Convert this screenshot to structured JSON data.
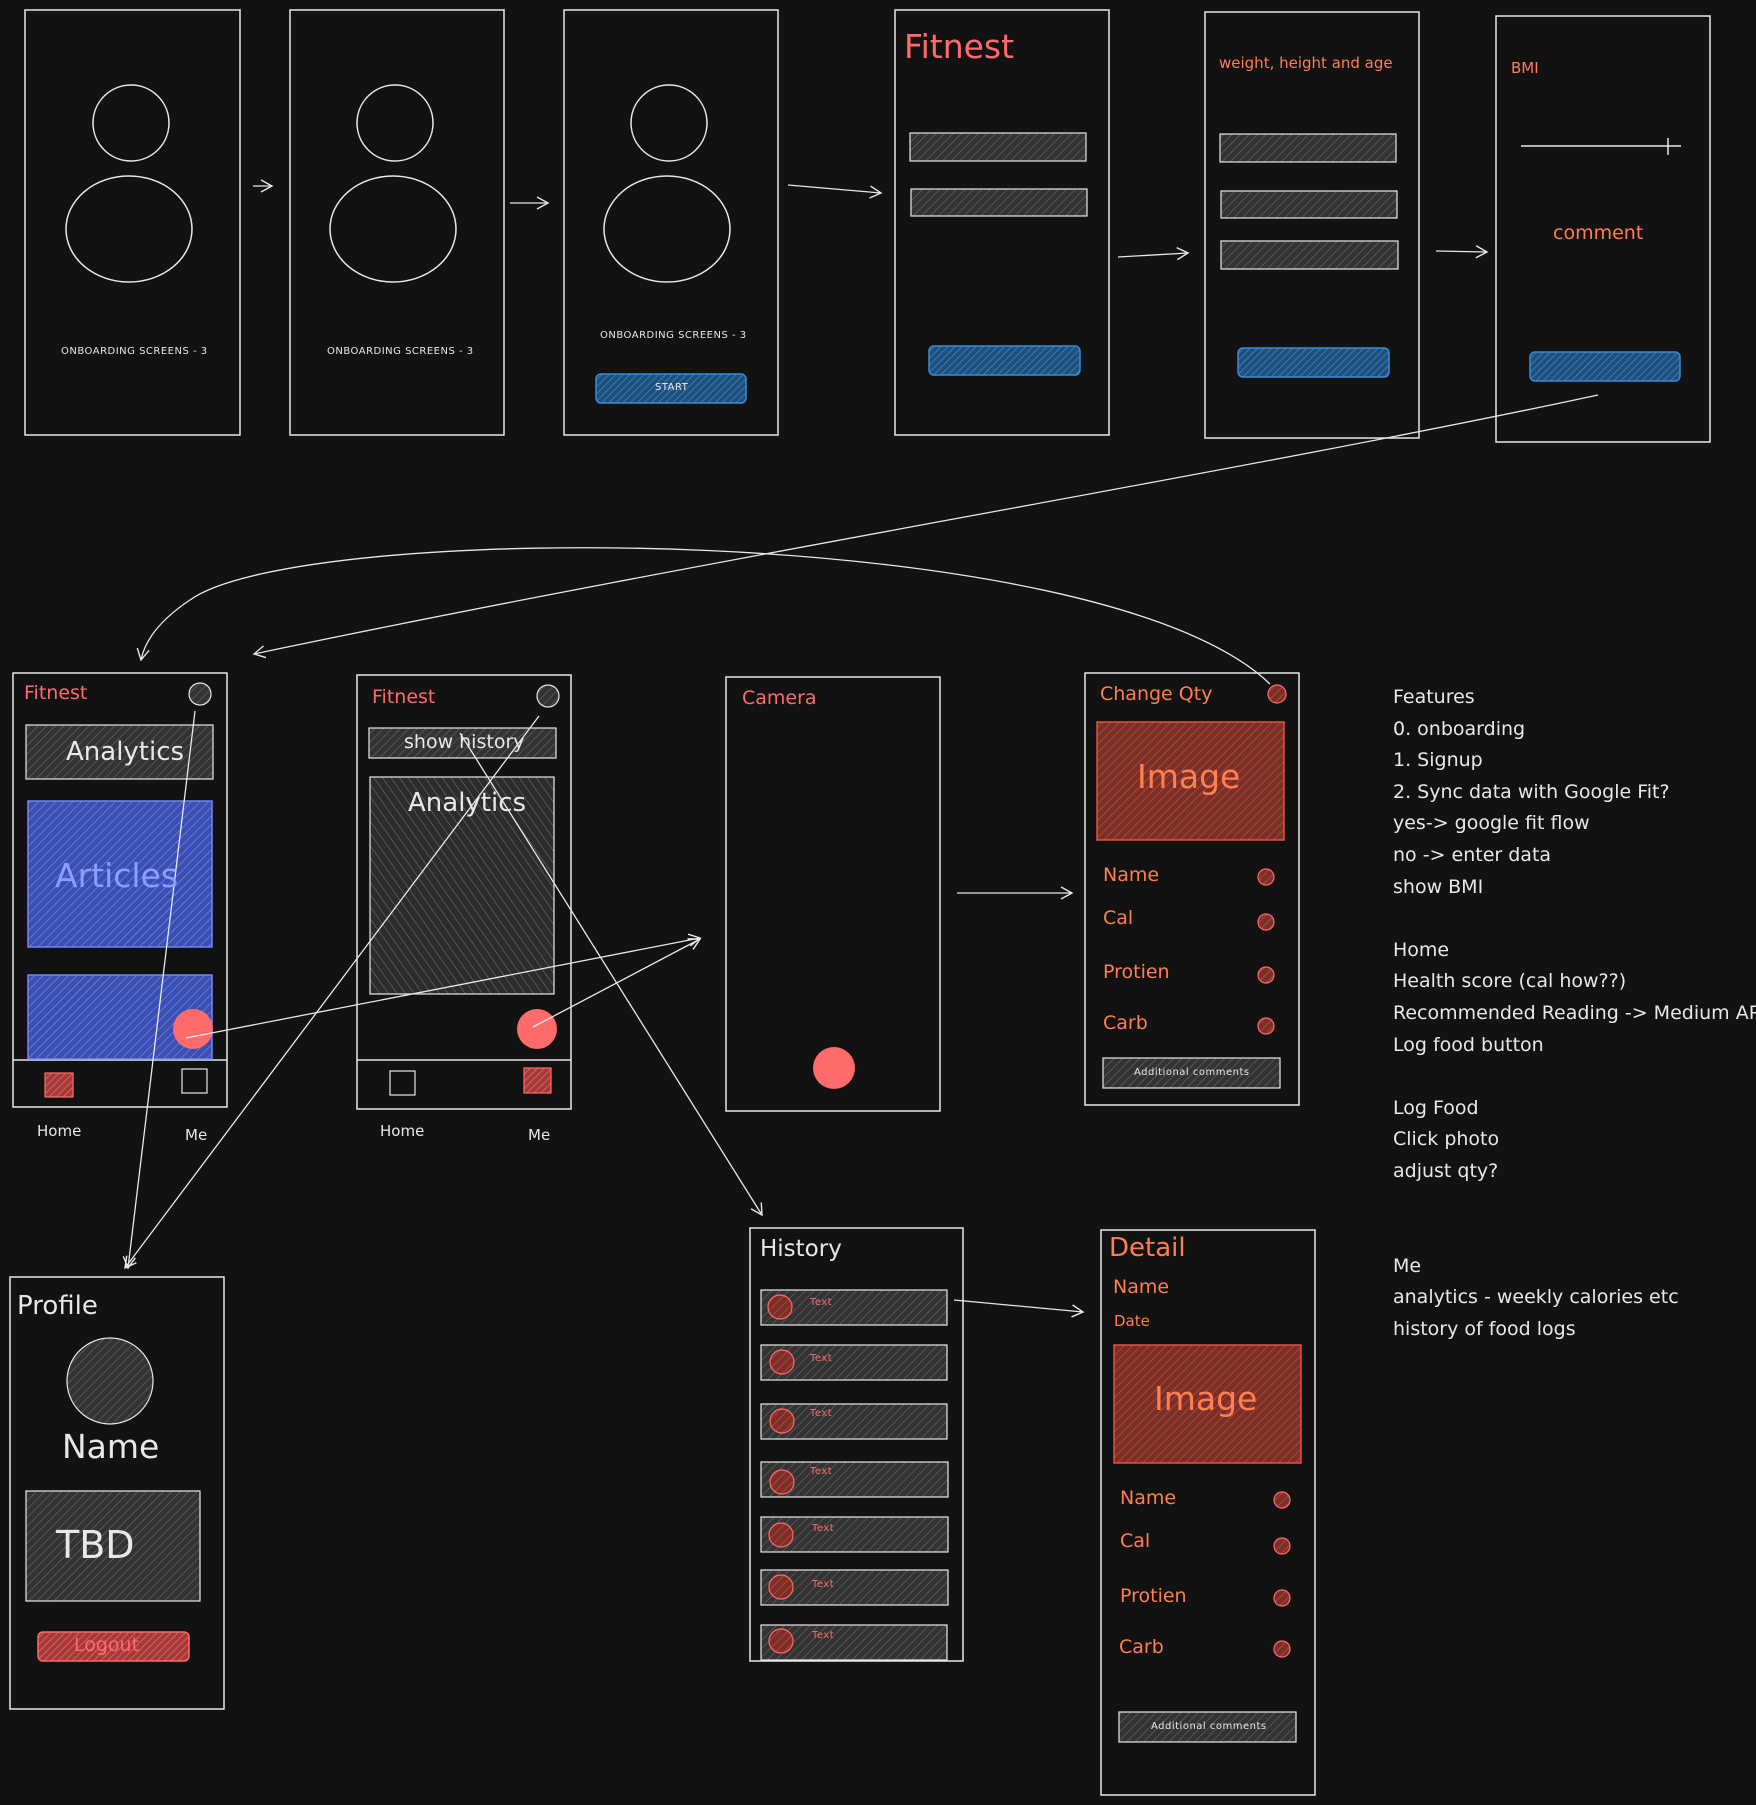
{
  "onboarding": {
    "screen1_caption": "ONBOARDING SCREENS - 3",
    "screen2_caption": "ONBOARDING SCREENS - 3",
    "screen3_caption": "ONBOARDING SCREENS - 3",
    "start_button": "START"
  },
  "signup": {
    "title": "Fitnest"
  },
  "body_data": {
    "title": "weight, height and age"
  },
  "bmi": {
    "title": "BMI",
    "comment": "comment"
  },
  "home": {
    "title": "Fitnest",
    "analytics": "Analytics",
    "articles": "Articles",
    "nav_home": "Home",
    "nav_me": "Me"
  },
  "me_screen": {
    "title": "Fitnest",
    "show_history": "show history",
    "analytics": "Analytics",
    "nav_home": "Home",
    "nav_me": "Me"
  },
  "camera": {
    "title": "Camera"
  },
  "change_qty": {
    "title": "Change Qty",
    "image": "Image",
    "fields": [
      "Name",
      "Cal",
      "Protien",
      "Carb"
    ],
    "additional_comments": "Additional comments"
  },
  "profile": {
    "title": "Profile",
    "name": "Name",
    "tbd": "TBD",
    "logout": "Logout"
  },
  "history": {
    "title": "History",
    "items": [
      "Text",
      "Text",
      "Text",
      "Text",
      "Text",
      "Text",
      "Text"
    ]
  },
  "detail": {
    "title": "Detail",
    "name": "Name",
    "date": "Date",
    "image": "Image",
    "fields": [
      "Name",
      "Cal",
      "Protien",
      "Carb"
    ],
    "additional_comments": "Additional comments"
  },
  "notes": {
    "features": [
      "Features",
      "0. onboarding",
      "1. Signup",
      "2. Sync data with Google Fit?",
      "yes-> google fit flow",
      "no -> enter data",
      "show BMI"
    ],
    "home": [
      "Home",
      "Health score (cal how??)",
      "Recommended Reading -> Medium API",
      "Log food button"
    ],
    "log_food": [
      "Log Food",
      "Click photo",
      "adjust qty?"
    ],
    "me": [
      "Me",
      "analytics - weekly calories etc",
      "history of food logs"
    ]
  },
  "colors": {
    "stroke": "#e8e8e8",
    "red": "#ff6b6b",
    "orange": "#ff7f50",
    "blue": "#5b7ff7",
    "gray_fill": "#4a4a4a"
  }
}
